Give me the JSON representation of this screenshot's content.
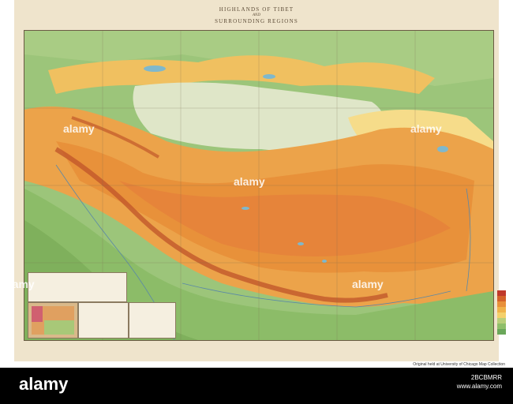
{
  "map": {
    "title_line1": "HIGHLANDS OF TIBET",
    "title_and": "AND",
    "title_line2": "SURROUNDING REGIONS",
    "legend_colors": [
      "#c0392b",
      "#d4622a",
      "#e8903a",
      "#f0b24a",
      "#f4d06a",
      "#b9cf7a",
      "#8fbf6a",
      "#6aa75a"
    ]
  },
  "credit": {
    "text": "Original held at University of Chicago Map Collection"
  },
  "stock": {
    "logo": "alamy",
    "watermark": "alamy",
    "image_id": "2BCBMRR",
    "url": "www.alamy.com"
  }
}
